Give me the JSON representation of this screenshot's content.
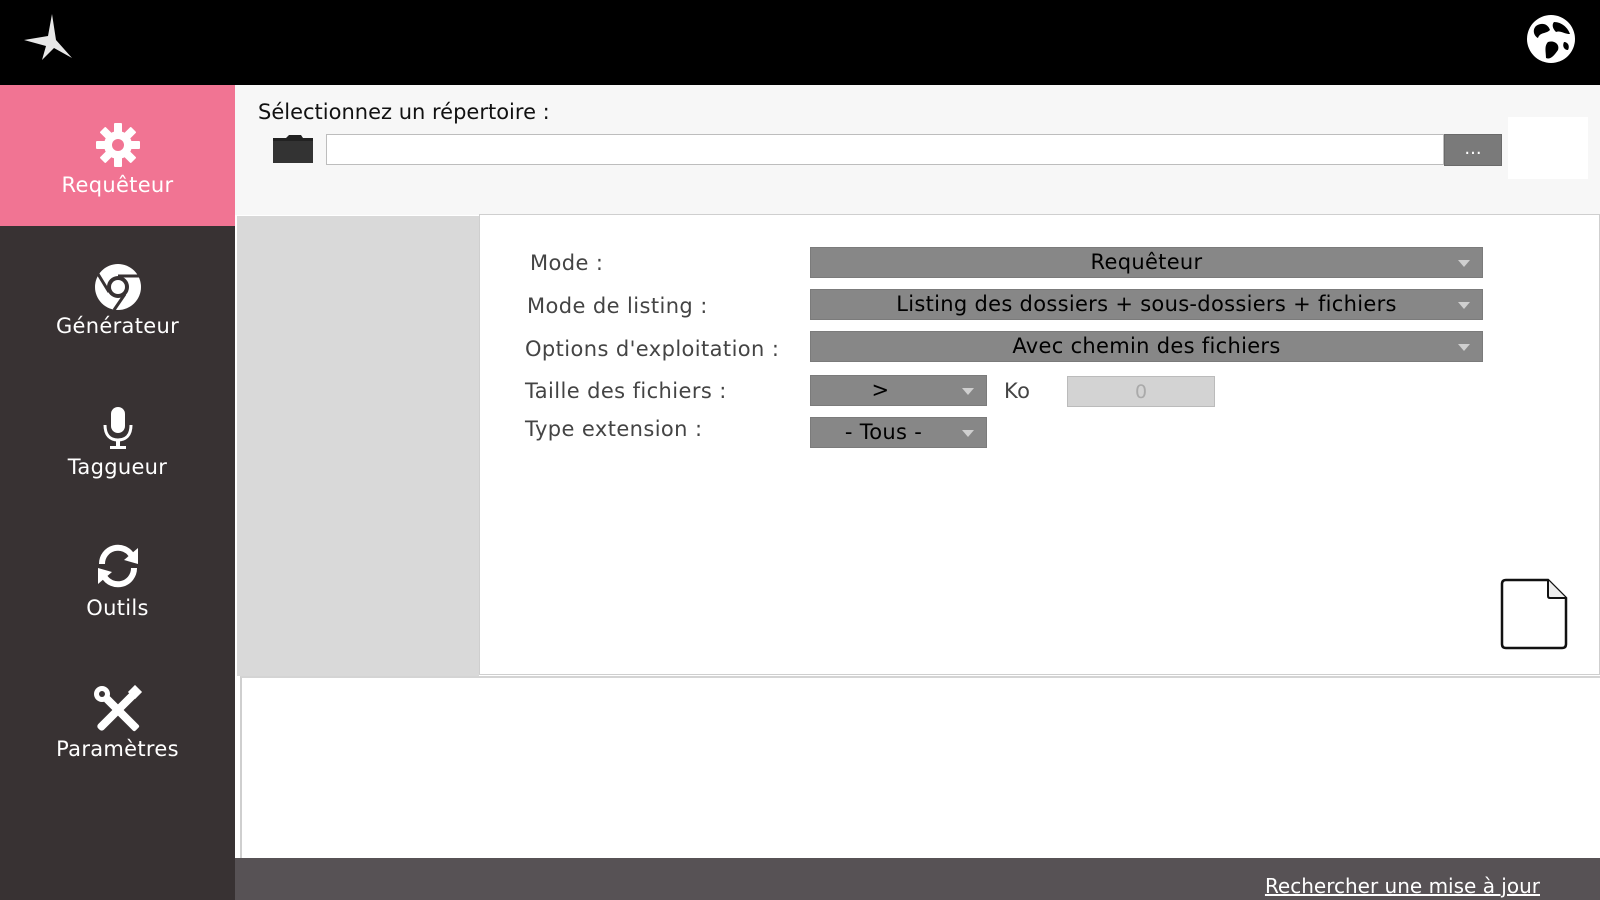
{
  "sidebar": {
    "items": [
      {
        "label": "Requêteur",
        "icon": "gear-icon",
        "active": true
      },
      {
        "label": "Générateur",
        "icon": "chrome-icon",
        "active": false
      },
      {
        "label": "Taggueur",
        "icon": "microphone-icon",
        "active": false
      },
      {
        "label": "Outils",
        "icon": "refresh-icon",
        "active": false
      },
      {
        "label": "Paramètres",
        "icon": "tools-icon",
        "active": false
      }
    ]
  },
  "directory": {
    "label": "Sélectionnez un répertoire :",
    "value": "",
    "browse_label": "..."
  },
  "form": {
    "mode": {
      "label": "Mode :",
      "value": "Requêteur"
    },
    "listing": {
      "label": "Mode de listing :",
      "value": "Listing des dossiers + sous-dossiers + fichiers"
    },
    "options": {
      "label": "Options d'exploitation :",
      "value": "Avec chemin des fichiers"
    },
    "size": {
      "label": "Taille des fichiers  :",
      "operator": ">",
      "unit": "Ko",
      "value": "0"
    },
    "extension": {
      "label": "Type extension :",
      "value": "- Tous -"
    }
  },
  "footer": {
    "update_link": "Rechercher une mise à jour"
  },
  "colors": {
    "accent": "#f17493",
    "sidebar": "#383233",
    "topbar": "#000000"
  }
}
